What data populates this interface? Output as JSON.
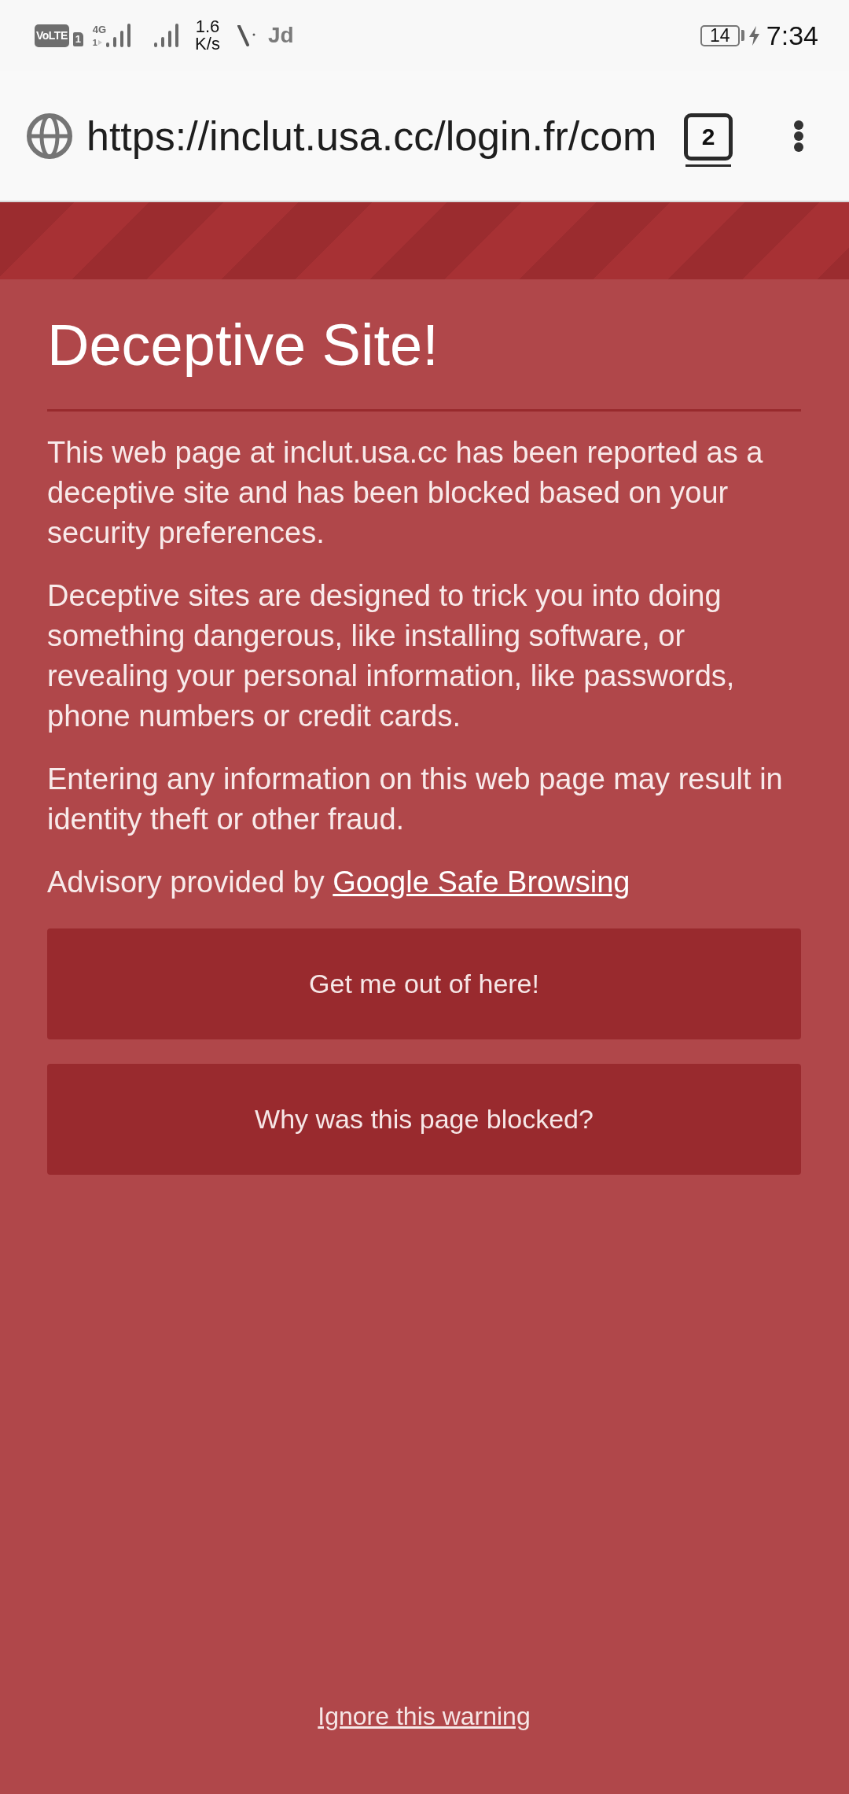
{
  "status_bar": {
    "volte_label": "VoLTE",
    "sim_label": "1",
    "network_type": "4G",
    "network_sim": "1",
    "speed_value": "1.6",
    "speed_unit": "K/s",
    "notification_text": "Jd",
    "battery_text": "14",
    "charging": true,
    "time": "7:34"
  },
  "address_bar": {
    "url": "https://inclut.usa.cc/login.fr/com",
    "tab_count": "2"
  },
  "warning": {
    "title": "Deceptive Site!",
    "paragraphs": [
      "This web page at inclut.usa.cc has been reported as a deceptive site and has been blocked based on your security preferences.",
      "Deceptive sites are designed to trick you into doing something dangerous, like installing software, or revealing your personal information, like passwords, phone numbers or credit cards.",
      "Entering any information on this web page may result in identity theft or other fraud."
    ],
    "advisory": {
      "text": "Advisory provided by ",
      "link": "Google Safe Browsing"
    },
    "buttons": [
      "Get me out of here!",
      "Why was this page blocked?"
    ],
    "ignore_link": "Ignore this warning"
  }
}
